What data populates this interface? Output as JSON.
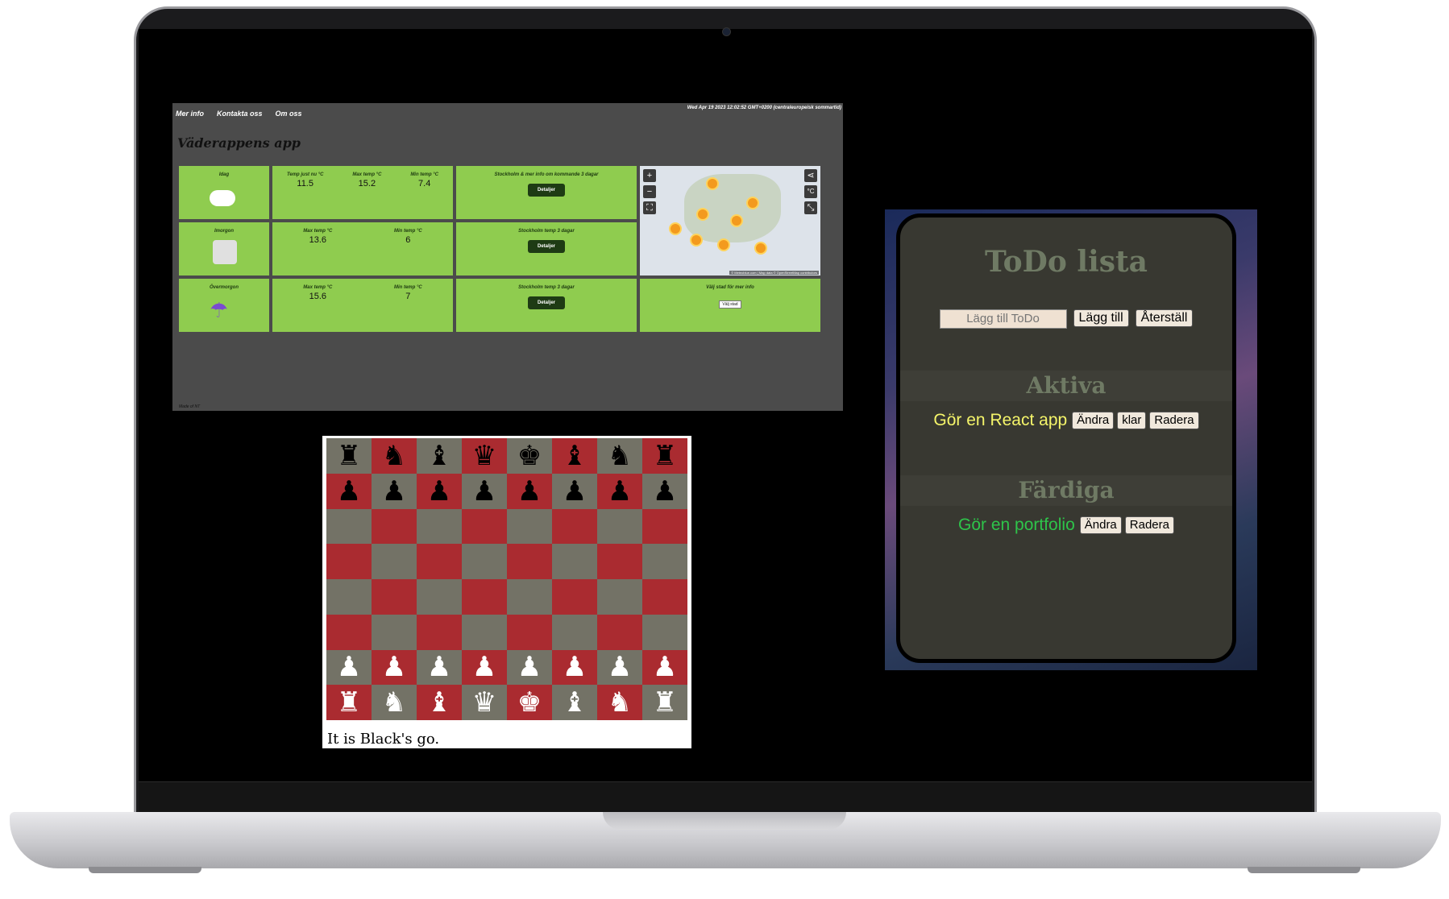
{
  "weather": {
    "nav": [
      "Mer info",
      "Kontakta oss",
      "Om oss"
    ],
    "datetime": "Wed Apr 19 2023 12:02:52 GMT+0200 (centraleuropeisk sommartid)",
    "title": "Väderappens app",
    "footer": "Made of NT",
    "days": [
      {
        "label": "Idag",
        "icon": "cloud-icon"
      },
      {
        "label": "Imorgon",
        "icon": "fog-icon"
      },
      {
        "label": "Övermorgon",
        "icon": "umbrella-icon"
      }
    ],
    "temps": [
      [
        {
          "label": "Temp just nu °C",
          "value": "11.5"
        },
        {
          "label": "Max temp °C",
          "value": "15.2"
        },
        {
          "label": "Min temp °C",
          "value": "7.4"
        }
      ],
      [
        {
          "label": "Max temp °C",
          "value": "13.6"
        },
        {
          "label": "Min temp °C",
          "value": "6"
        }
      ],
      [
        {
          "label": "Max temp °C",
          "value": "15.6"
        },
        {
          "label": "Min temp °C",
          "value": "7"
        }
      ]
    ],
    "detail_labels": [
      "Stockholm & mer info om kommande 3 dagar",
      "Stockholm temp 3 dagar",
      "Stockholm temp 3 dagar"
    ],
    "detail_button": "Detaljer",
    "map_credit": "© Meteoblue.com | Map data © OpenStreetMap contributors",
    "map_unit": "°C",
    "select_label": "Välj stad för mer info",
    "select_value": "Välj stad"
  },
  "chess": {
    "status": "It is Black's go.",
    "rows": [
      [
        "♜",
        "♞",
        "♝",
        "♛",
        "♚",
        "♝",
        "♞",
        "♜"
      ],
      [
        "♟",
        "♟",
        "♟",
        "♟",
        "♟",
        "♟",
        "♟",
        "♟"
      ],
      [
        "",
        "",
        "",
        "",
        "",
        "",
        "",
        ""
      ],
      [
        "",
        "",
        "",
        "",
        "",
        "",
        "",
        ""
      ],
      [
        "",
        "",
        "",
        "",
        "",
        "",
        "",
        ""
      ],
      [
        "",
        "",
        "",
        "",
        "",
        "",
        "",
        ""
      ],
      [
        "♟",
        "♟",
        "♟",
        "♟",
        "♟",
        "♟",
        "♟",
        "♟"
      ],
      [
        "♜",
        "♞",
        "♝",
        "♛",
        "♚",
        "♝",
        "♞",
        "♜"
      ]
    ]
  },
  "todo": {
    "title": "ToDo lista",
    "input_placeholder": "Lägg till ToDo",
    "add_button": "Lägg till",
    "reset_button": "Återställ",
    "active_heading": "Aktiva",
    "done_heading": "Färdiga",
    "active_item": {
      "text": "Gör en React app",
      "color": "#f5f56a",
      "buttons": [
        "Ändra",
        "klar",
        "Radera"
      ]
    },
    "done_item": {
      "text": "Gör en portfolio",
      "color": "#2ec44a",
      "buttons": [
        "Ändra",
        "Radera"
      ]
    }
  }
}
